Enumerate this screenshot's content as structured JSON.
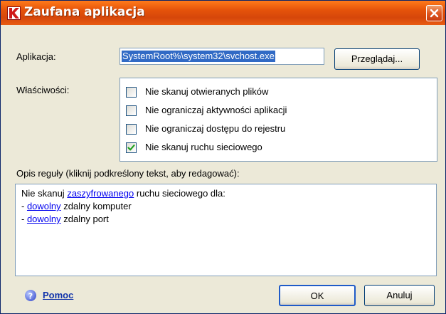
{
  "window": {
    "title": "Zaufana aplikacja",
    "app_icon": "kaspersky-k-logo",
    "close_icon": "close-x"
  },
  "application": {
    "label": "Aplikacja:",
    "path_value": "SystemRoot%\\system32\\svchost.exe",
    "browse_label": "Przeglądaj..."
  },
  "properties": {
    "label": "Właściwości:",
    "options": [
      {
        "label": "Nie skanuj otwieranych plików",
        "checked": false
      },
      {
        "label": "Nie ograniczaj aktywności aplikacji",
        "checked": false
      },
      {
        "label": "Nie ograniczaj dostępu do rejestru",
        "checked": false
      },
      {
        "label": "Nie skanuj ruchu sieciowego",
        "checked": true
      }
    ]
  },
  "rule": {
    "label": "Opis reguły (kliknij podkreślony tekst, aby redagować):",
    "lines": [
      {
        "pre": "Nie skanuj ",
        "link": "zaszyfrowanego",
        "post": " ruchu sieciowego dla:"
      },
      {
        "pre": "- ",
        "link": "dowolny",
        "post": " zdalny komputer"
      },
      {
        "pre": "- ",
        "link": "dowolny",
        "post": " zdalny port"
      }
    ]
  },
  "footer": {
    "help_label": "Pomoc",
    "help_icon": "question-circle-icon",
    "ok_label": "OK",
    "cancel_label": "Anuluj"
  },
  "colors": {
    "titlebar": "#e4520a",
    "selection": "#316ac5",
    "link": "#0000ee",
    "checkmark": "#21a121"
  }
}
